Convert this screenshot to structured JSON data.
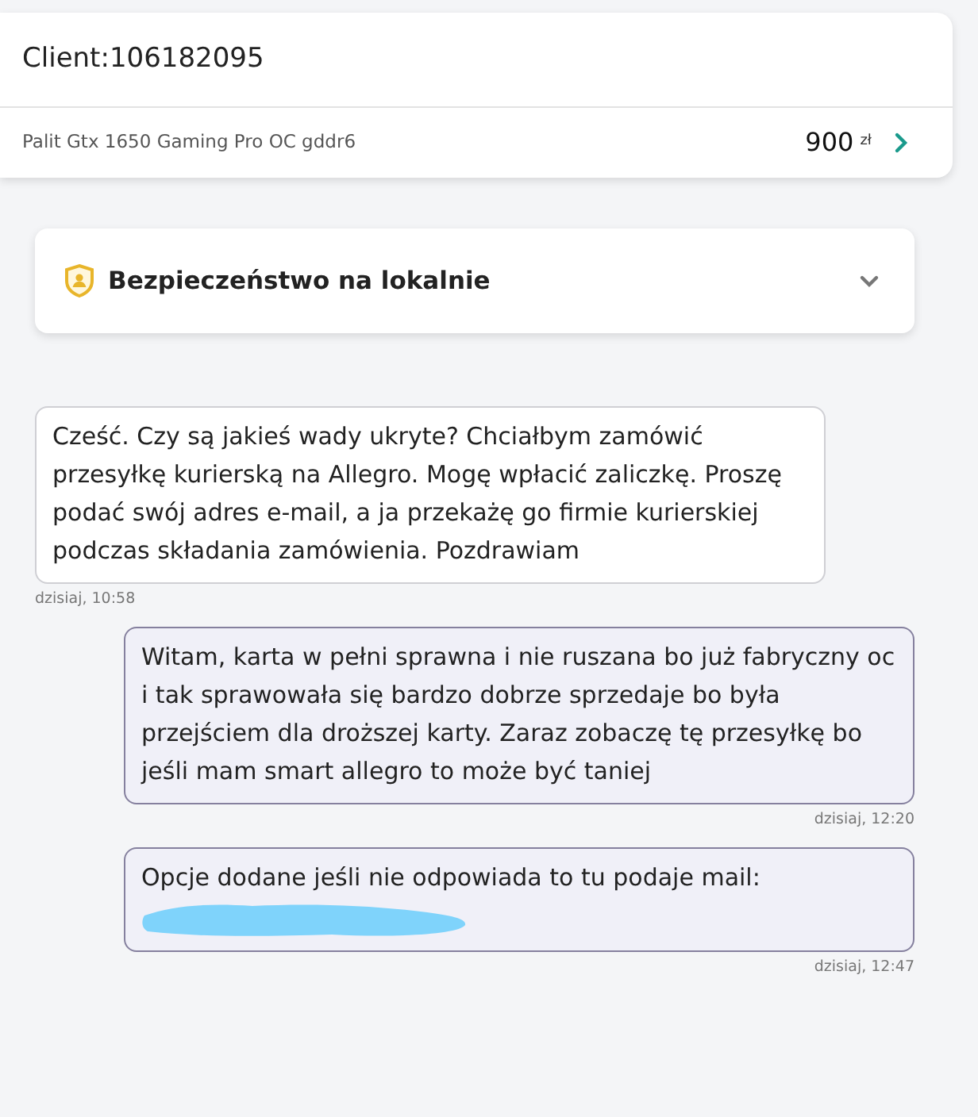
{
  "header": {
    "title": "Client:106182095"
  },
  "offer": {
    "name": "Palit Gtx 1650 Gaming Pro OC gddr6",
    "price": "900",
    "currency": "zł"
  },
  "safety_panel": {
    "title": "Bezpieczeństwo na lokalnie",
    "expanded": false
  },
  "messages": [
    {
      "kind": "incoming",
      "text": "Cześć. Czy są jakieś wady ukryte? Chciałbym zamówić przesyłkę kurierską na Allegro. Mogę wpłacić zaliczkę. Proszę podać swój adres e-mail, a ja przekażę go firmie kurierskiej podczas składania zamówienia. Pozdrawiam",
      "time": "dzisiaj, 10:58"
    },
    {
      "kind": "outgoing",
      "text": "Witam, karta w pełni sprawna i nie ruszana bo już fabryczny oc i tak sprawowała się bardzo dobrze sprzedaje bo była przejściem dla droższej karty. Zaraz zobaczę tę przesyłkę bo jeśli mam smart allegro to może być taniej",
      "time": "dzisiaj, 12:20"
    },
    {
      "kind": "outgoing",
      "text": "Opcje dodane jeśli nie odpowiada to tu podaje mail:",
      "redacted": true,
      "time": "dzisiaj, 12:47"
    }
  ]
}
